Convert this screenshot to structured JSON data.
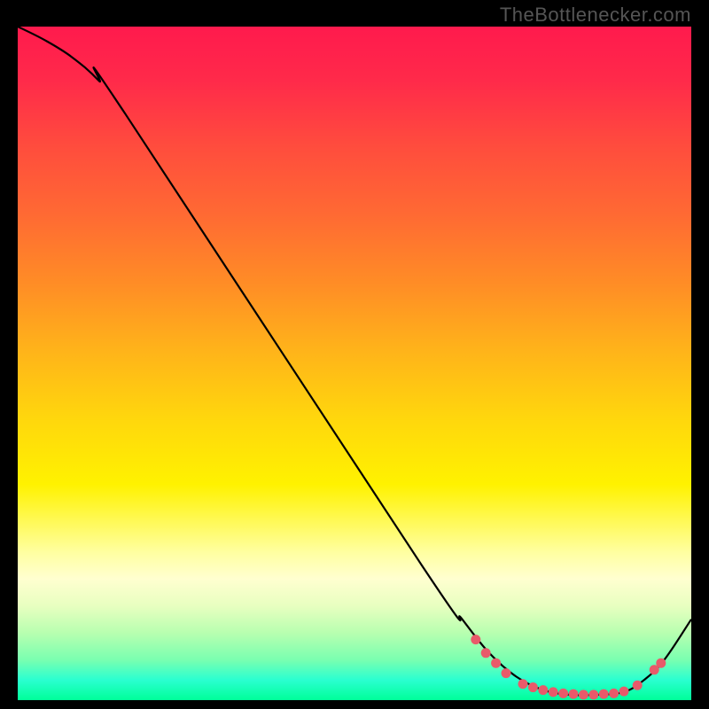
{
  "attribution": "TheBottlenecker.com",
  "chart_data": {
    "type": "line",
    "title": "",
    "xlabel": "",
    "ylabel": "",
    "xlim": [
      0,
      100
    ],
    "ylim": [
      0,
      100
    ],
    "curve": [
      {
        "x": 0,
        "y": 100
      },
      {
        "x": 4,
        "y": 98
      },
      {
        "x": 8,
        "y": 95.5
      },
      {
        "x": 12,
        "y": 92
      },
      {
        "x": 16,
        "y": 87
      },
      {
        "x": 60,
        "y": 20
      },
      {
        "x": 66,
        "y": 12
      },
      {
        "x": 70,
        "y": 7
      },
      {
        "x": 74,
        "y": 3.5
      },
      {
        "x": 78,
        "y": 1.5
      },
      {
        "x": 82,
        "y": 0.8
      },
      {
        "x": 86,
        "y": 0.8
      },
      {
        "x": 90,
        "y": 1.2
      },
      {
        "x": 93,
        "y": 3
      },
      {
        "x": 96,
        "y": 6
      },
      {
        "x": 100,
        "y": 12
      }
    ],
    "markers": [
      {
        "x": 68,
        "y": 9
      },
      {
        "x": 69.5,
        "y": 7
      },
      {
        "x": 71,
        "y": 5.5
      },
      {
        "x": 72.5,
        "y": 4
      },
      {
        "x": 75,
        "y": 2.4
      },
      {
        "x": 76.5,
        "y": 1.9
      },
      {
        "x": 78,
        "y": 1.5
      },
      {
        "x": 79.5,
        "y": 1.2
      },
      {
        "x": 81,
        "y": 1.0
      },
      {
        "x": 82.5,
        "y": 0.9
      },
      {
        "x": 84,
        "y": 0.8
      },
      {
        "x": 85.5,
        "y": 0.8
      },
      {
        "x": 87,
        "y": 0.9
      },
      {
        "x": 88.5,
        "y": 1.0
      },
      {
        "x": 90,
        "y": 1.3
      },
      {
        "x": 92,
        "y": 2.2
      },
      {
        "x": 94.5,
        "y": 4.5
      },
      {
        "x": 95.5,
        "y": 5.5
      }
    ],
    "marker_color": "#e85a6a",
    "curve_color": "#000000"
  }
}
